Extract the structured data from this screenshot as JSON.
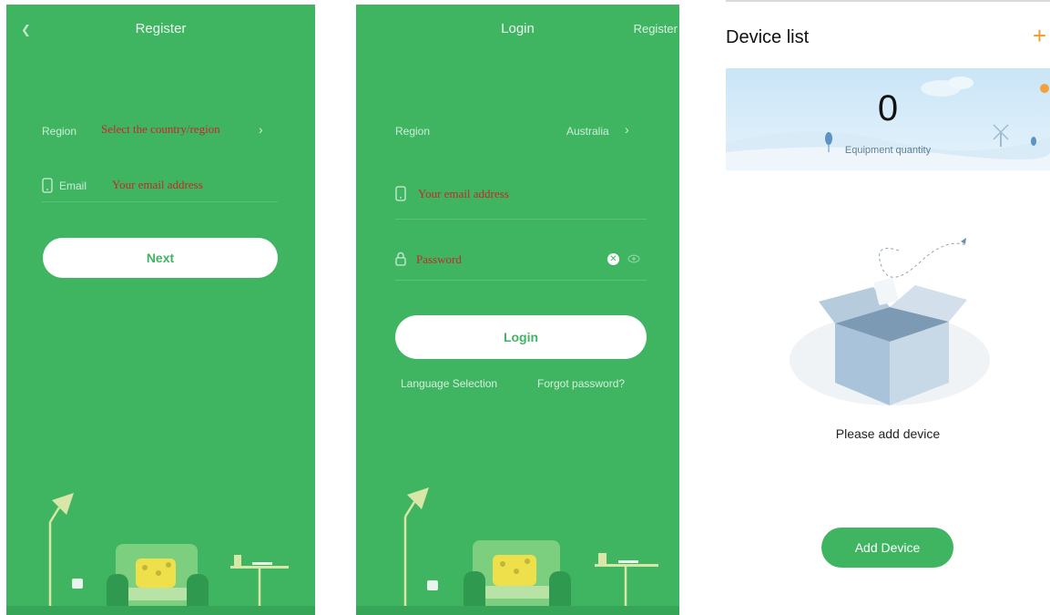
{
  "register_screen": {
    "title": "Register",
    "region_label": "Region",
    "region_value": "Select the country/region",
    "email_label": "Email",
    "email_placeholder": "Your email address",
    "next_label": "Next"
  },
  "login_screen": {
    "title": "Login",
    "register_link": "Register",
    "region_label": "Region",
    "region_value": "Australia",
    "email_placeholder": "Your email address",
    "password_placeholder": "Password",
    "login_label": "Login",
    "language_link": "Language Selection",
    "forgot_link": "Forgot password?"
  },
  "device_screen": {
    "title": "Device list",
    "count": "0",
    "count_label": "Equipment quantity",
    "empty_text": "Please add device",
    "add_label": "Add Device"
  },
  "colors": {
    "brand_green": "#3fb562",
    "accent_orange": "#f39a2b",
    "hint_red": "#c62828"
  }
}
